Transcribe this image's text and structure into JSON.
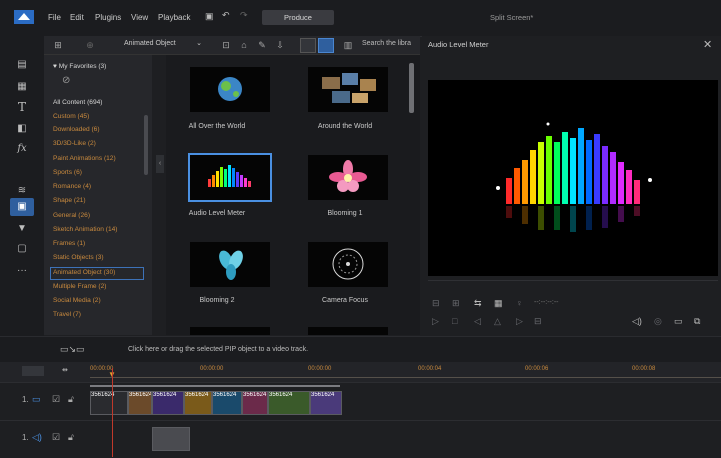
{
  "menubar": {
    "items": [
      "File",
      "Edit",
      "Plugins",
      "View",
      "Playback"
    ],
    "produce_label": "Produce",
    "window_title": "Split Screen*"
  },
  "toolbar": {
    "dropdown_value": "Animated Object",
    "search_placeholder": "Search the libra"
  },
  "categories": {
    "favorites": "My Favorites (3)",
    "items": [
      "All Content (694)",
      "Custom (45)",
      "Downloaded (6)",
      "3D/3D-Like (2)",
      "Paint Animations (12)",
      "Sports (6)",
      "Romance (4)",
      "Shape (21)",
      "General (26)",
      "Sketch Animation (14)",
      "Frames (1)",
      "Static Objects (3)",
      "Animated Object (30)",
      "Multiple Frame (2)",
      "Social Media (2)",
      "Travel (7)"
    ],
    "selected": "Animated Object (30)"
  },
  "objects": [
    {
      "label": "All Over the World"
    },
    {
      "label": "Around the World"
    },
    {
      "label": "Audio Level Meter"
    },
    {
      "label": "Blooming 1"
    },
    {
      "label": "Blooming 2"
    },
    {
      "label": "Camera Focus"
    }
  ],
  "preview": {
    "title": "Audio Level Meter",
    "timecode": "--:--:--:--"
  },
  "pip_hint": "Click here or drag the selected PIP object to a video track.",
  "timeline": {
    "ruler": [
      "00:00:00",
      "00:00:00",
      "00:00:00",
      "00:00:04",
      "00:00:06",
      "00:00:08"
    ],
    "tracks": [
      {
        "label": "1."
      },
      {
        "label": "1."
      }
    ],
    "clip_labels": [
      "3561624",
      "3561624",
      "3561624",
      "3561624",
      "3561624",
      "3561624",
      "3561624",
      "3561624"
    ]
  },
  "colors": {
    "accent": "#2f5f9e",
    "category_text": "#c98a3e",
    "playhead": "#c0392b"
  }
}
